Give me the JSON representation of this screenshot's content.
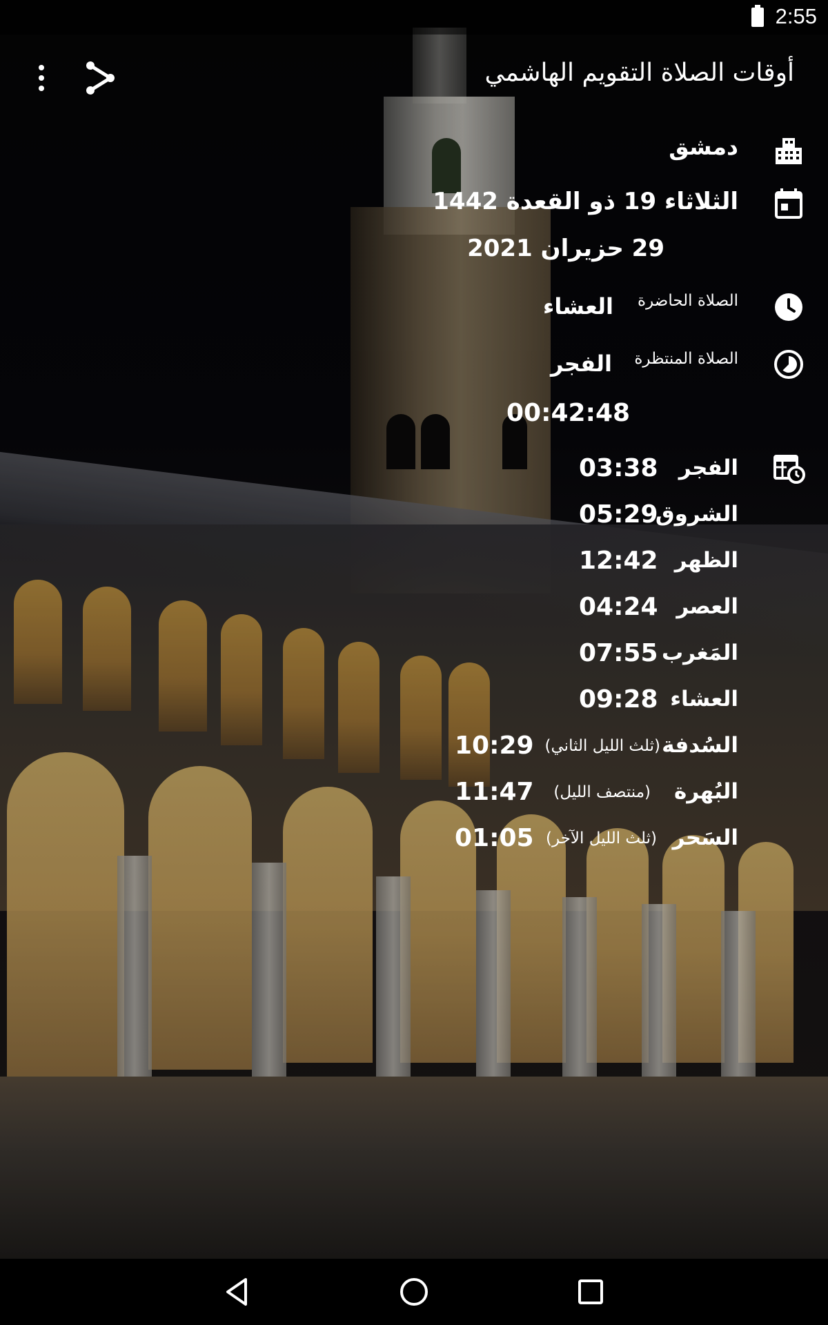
{
  "status_bar": {
    "time": "2:55"
  },
  "app_bar": {
    "title": "أوقات الصلاة التقويم الهاشمي"
  },
  "location": {
    "city": "دمشق"
  },
  "date": {
    "hijri": "الثلاثاء  19 ذو القعدة 1442",
    "gregorian": "29 حزيران 2021"
  },
  "current_prayer": {
    "label": "الصلاة الحاضرة",
    "value": "العشاء"
  },
  "next_prayer": {
    "label": "الصلاة المنتظرة",
    "value": "الفجر",
    "countdown": "00:42:48"
  },
  "prayers": [
    {
      "name": "الفجر",
      "time": "03:38",
      "note": ""
    },
    {
      "name": "الشروق",
      "time": "05:29",
      "note": ""
    },
    {
      "name": "الظهر",
      "time": "12:42",
      "note": ""
    },
    {
      "name": "العصر",
      "time": "04:24",
      "note": ""
    },
    {
      "name": "المَغرب",
      "time": "07:55",
      "note": ""
    },
    {
      "name": "العشاء",
      "time": "09:28",
      "note": ""
    },
    {
      "name": "السُدفة",
      "time": "10:29",
      "note": "(ثلث الليل الثاني)"
    },
    {
      "name": "البُهرة",
      "time": "11:47",
      "note": "(منتصف الليل)"
    },
    {
      "name": "السَحر",
      "time": "01:05",
      "note": "(ثلث الليل الآخر)"
    }
  ],
  "icons": {
    "city": "city-buildings-icon",
    "date": "calendar-icon",
    "current": "clock-icon",
    "next": "timelapse-icon",
    "schedule": "schedule-calendar-icon",
    "share": "share-icon",
    "overflow": "more-vertical-icon"
  },
  "colors": {
    "text": "#ffffff",
    "status_bar": "#000000",
    "nav_bar": "#000000"
  }
}
